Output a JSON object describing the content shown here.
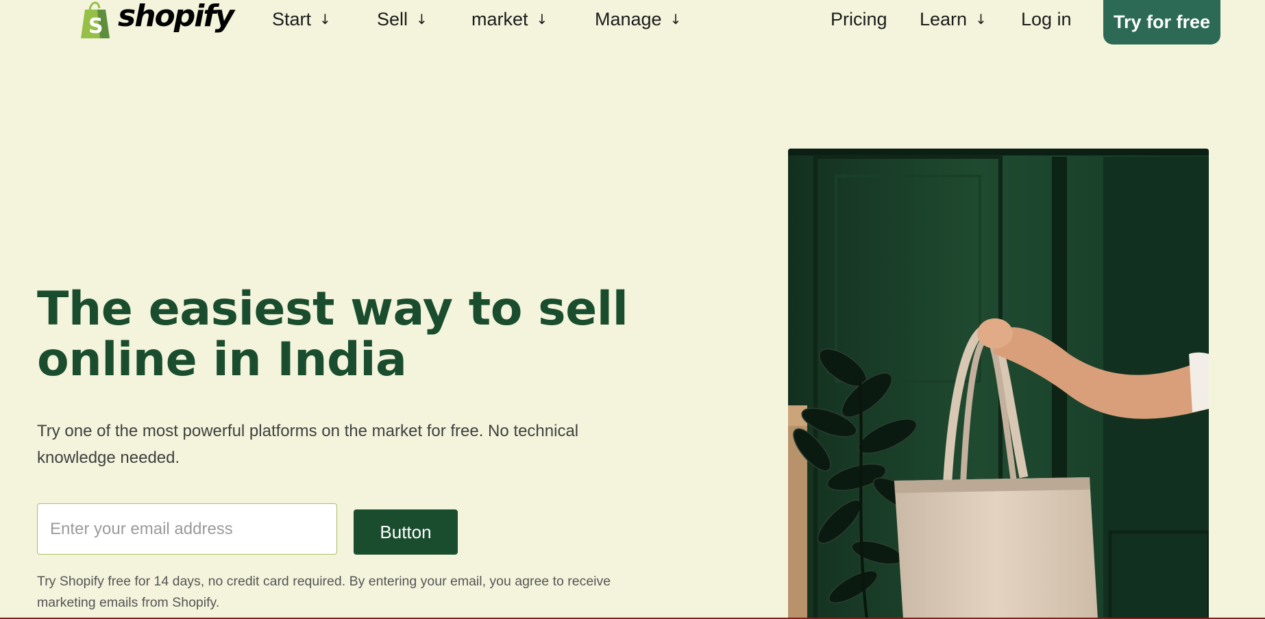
{
  "header": {
    "logo_text": "shopify",
    "nav": [
      {
        "label": "Start",
        "has_dropdown": true
      },
      {
        "label": "Sell",
        "has_dropdown": true
      },
      {
        "label": "market",
        "has_dropdown": true
      },
      {
        "label": "Manage",
        "has_dropdown": true
      }
    ],
    "right_nav": {
      "pricing": "Pricing",
      "learn": "Learn",
      "login": "Log in",
      "cta": "Try for free"
    },
    "dropdown_icon": "arrow-down-icon"
  },
  "hero": {
    "title_line1": "The easiest way to sell",
    "title_line2": "online in India",
    "subtitle": "Try one of the most powerful platforms on the market for free. No technical knowledge needed.",
    "email_placeholder": "Enter your email address",
    "email_value": "",
    "button_label": "Button",
    "disclaimer": "Try Shopify free for 14 days, no credit card required. By entering your email, you agree to receive marketing emails from Shopify."
  },
  "colors": {
    "background": "#f4f4dc",
    "brand_green": "#1a4d2e",
    "cta_green": "#2c6a55",
    "logo_green": "#95bf47",
    "input_border": "#a9bf63",
    "bottom_rule": "#8a1c1c"
  }
}
